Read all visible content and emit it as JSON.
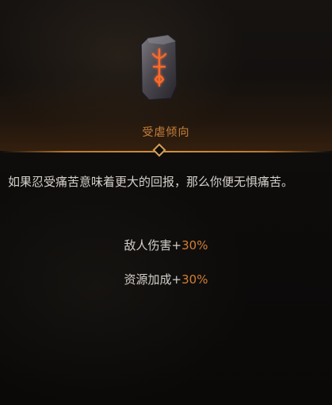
{
  "tooltip": {
    "icon": "rune-stone-icon",
    "title": "受虐倾向",
    "description": "如果忍受痛苦意味着更大的回报，那么你便无惧痛苦。",
    "stats": [
      {
        "label": "敌人伤害",
        "sign": "+",
        "value": "30%"
      },
      {
        "label": "资源加成",
        "sign": "+",
        "value": "30%"
      }
    ]
  },
  "colors": {
    "title": "#c9803b",
    "text": "#d3d0cb",
    "value": "#d27f36",
    "divider": "#b7772e"
  }
}
